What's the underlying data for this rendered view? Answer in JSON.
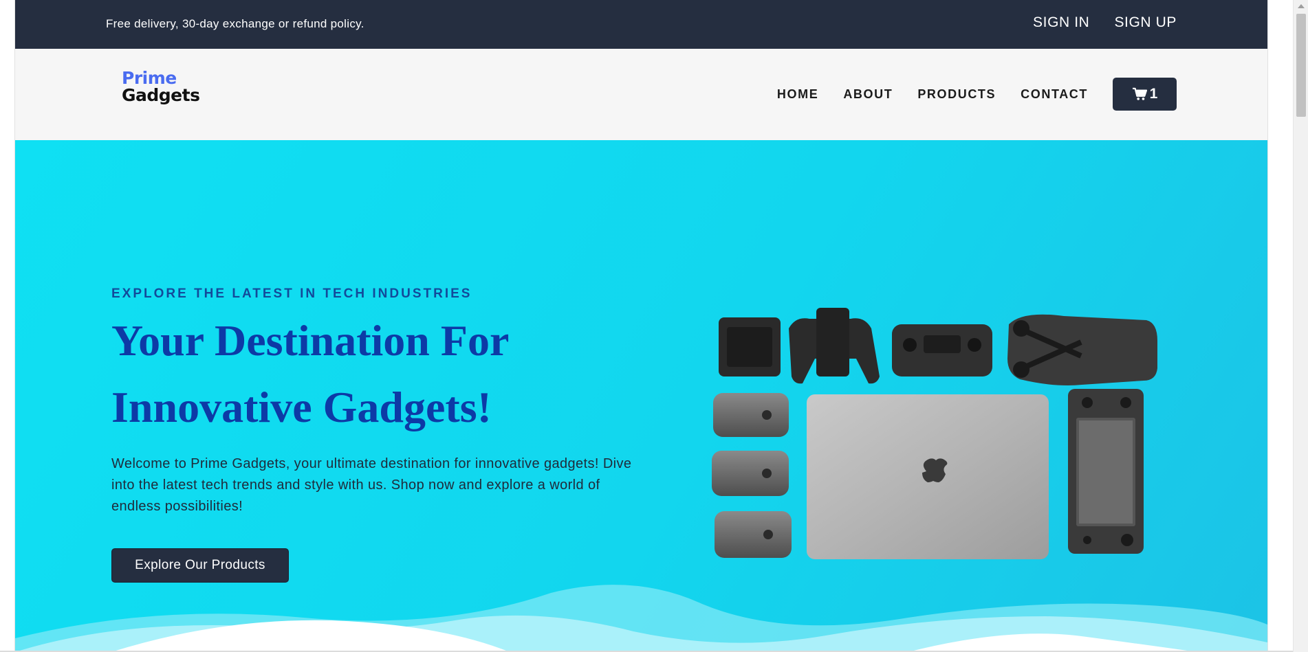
{
  "topbar": {
    "promo": "Free delivery, 30-day exchange or refund policy.",
    "sign_in": "SIGN IN",
    "sign_up": "SIGN UP"
  },
  "header": {
    "logo_line1": "Prime",
    "logo_line2": "Gadgets",
    "nav": [
      "HOME",
      "ABOUT",
      "PRODUCTS",
      "CONTACT"
    ],
    "cart_count": "1",
    "cart_icon": "shopping-cart-icon"
  },
  "hero": {
    "eyebrow": "EXPLORE THE LATEST IN TECH INDUSTRIES",
    "headline": "Your Destination For Innovative Gadgets!",
    "description": "Welcome to Prime Gadgets, your ultimate destination for innovative gadgets! Dive into the latest tech trends and style with us. Shop now and explore a world of endless possibilities!",
    "cta": "Explore Our Products"
  },
  "colors": {
    "dark_navy": "#252e40",
    "hero_cyan": "#12d6ee",
    "headline_blue": "#0d3aa6",
    "logo_blue": "#4a6cf0"
  }
}
